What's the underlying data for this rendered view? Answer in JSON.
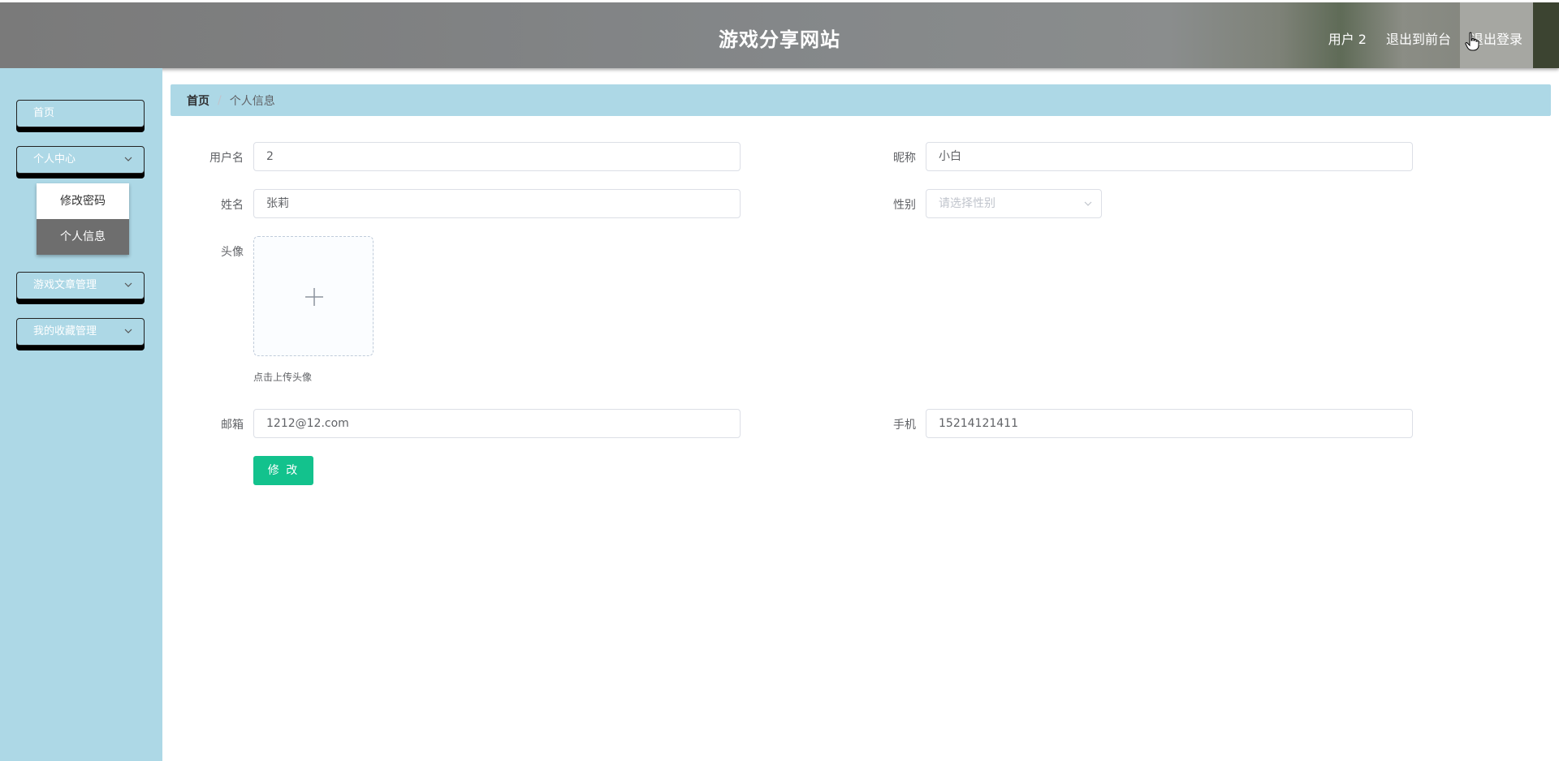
{
  "header": {
    "title": "游戏分享网站",
    "user_label": "用户 2",
    "back_to_front": "退出到前台",
    "logout": "退出登录"
  },
  "sidebar": {
    "items": [
      {
        "label": "首页",
        "icon": "none"
      },
      {
        "label": "个人中心",
        "icon": "chevron-down-icon"
      },
      {
        "label": "游戏文章管理",
        "icon": "chevron-down-icon"
      },
      {
        "label": "我的收藏管理",
        "icon": "chevron-down-icon"
      }
    ],
    "submenu": [
      {
        "label": "修改密码",
        "active": false
      },
      {
        "label": "个人信息",
        "active": true
      }
    ]
  },
  "breadcrumb": {
    "home": "首页",
    "separator": "/",
    "current": "个人信息"
  },
  "form": {
    "username": {
      "label": "用户名",
      "value": "2"
    },
    "nickname": {
      "label": "昵称",
      "value": "小白"
    },
    "realname": {
      "label": "姓名",
      "value": "张莉"
    },
    "gender": {
      "label": "性别",
      "placeholder": "请选择性别"
    },
    "avatar": {
      "label": "头像",
      "tip": "点击上传头像"
    },
    "email": {
      "label": "邮箱",
      "value": "1212@12.com"
    },
    "phone": {
      "label": "手机",
      "value": "15214121411"
    },
    "submit_label": "修 改"
  },
  "colors": {
    "sidebar_bg": "#add8e6",
    "active_submenu": "#6e6e6e",
    "primary_button": "#13c28d"
  }
}
